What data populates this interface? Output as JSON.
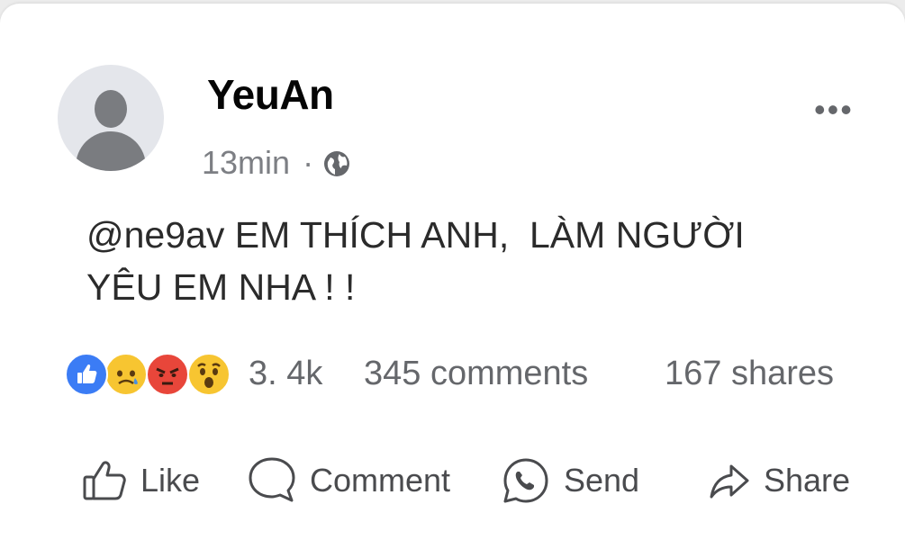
{
  "post": {
    "author": "YeuAn",
    "time": "13min",
    "separator": "·",
    "privacy_icon": "globe-icon",
    "more_icon": "more-options-icon",
    "text": "@ne9av EM THÍCH ANH,  LÀM NGƯỜI\nYÊU EM NHA ! !"
  },
  "stats": {
    "reaction_icons": [
      "like-icon",
      "sad-icon",
      "angry-icon",
      "wow-icon"
    ],
    "reaction_count": "3. 4k",
    "comments": "345 comments",
    "shares": "167 shares"
  },
  "actions": {
    "like": "Like",
    "comment": "Comment",
    "send": "Send",
    "share": "Share"
  },
  "colors": {
    "like_blue": "#3b7cf5",
    "reaction_yellow": "#f7c531",
    "angry_red": "#e8463a",
    "secondary_text": "#65676b"
  }
}
